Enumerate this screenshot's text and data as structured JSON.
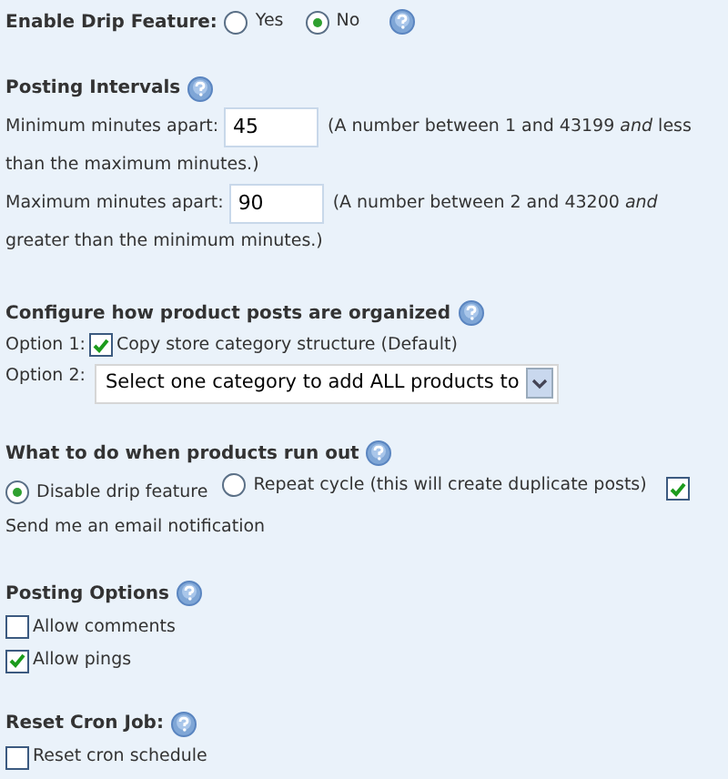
{
  "drip": {
    "label": "Enable Drip Feature:",
    "options": [
      {
        "label": "Yes",
        "selected": false
      },
      {
        "label": "No",
        "selected": true
      }
    ]
  },
  "intervals": {
    "heading": "Posting Intervals",
    "rows": [
      {
        "label": "Minimum minutes apart:",
        "value": "45",
        "note": [
          "(A number between 1 and 43199 *and* less",
          "than the maximum minutes.)"
        ]
      },
      {
        "label": "Maximum minutes apart:",
        "value": "90",
        "note": [
          "(A number between 2 and 43200 *and*",
          "greater than the minimum minutes.)"
        ]
      }
    ]
  },
  "organize": {
    "heading": "Configure how product posts are organized",
    "option1": {
      "label": "Option 1:",
      "text": "Copy store category structure (Default)",
      "checked": true
    },
    "option2": {
      "label": "Option 2:",
      "select": "Select one category to add ALL products to"
    }
  },
  "runout": {
    "heading": "What to do when products run out",
    "options": [
      {
        "label": "Disable drip feature",
        "selected": true
      },
      {
        "label": "Repeat cycle (this will create duplicate posts)",
        "selected": false
      }
    ],
    "email": {
      "label": "Send me an email notification",
      "checked": true
    }
  },
  "posting": {
    "heading": "Posting Options",
    "items": [
      {
        "label": "Allow comments",
        "checked": false
      },
      {
        "label": "Allow pings",
        "checked": true
      }
    ]
  },
  "cron": {
    "heading": "Reset Cron Job:",
    "items": [
      {
        "label": "Reset cron schedule",
        "checked": false
      }
    ]
  }
}
